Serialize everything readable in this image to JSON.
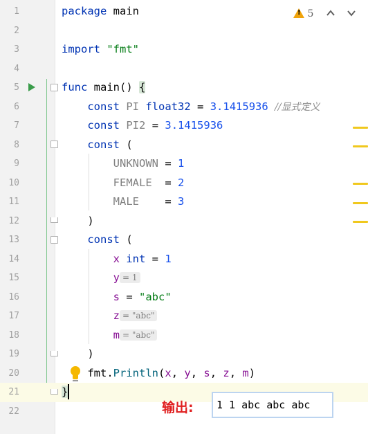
{
  "editor": {
    "warnings": {
      "icon": "warning-triangle-icon",
      "count": "5"
    },
    "nav": {
      "prev_icon": "chevron-up-icon",
      "next_icon": "chevron-down-icon",
      "prev_glyph": "⌃",
      "next_glyph": "⌄"
    },
    "line_numbers": [
      "1",
      "2",
      "3",
      "4",
      "5",
      "6",
      "7",
      "8",
      "9",
      "10",
      "11",
      "12",
      "13",
      "14",
      "15",
      "16",
      "17",
      "18",
      "19",
      "20",
      "21",
      "22"
    ],
    "lines": {
      "l1_kw": "package",
      "l1_name": "main",
      "l3_kw": "import",
      "l3_str": "\"fmt\"",
      "l5_kw": "func",
      "l5_name": "main",
      "l6_kw": "const",
      "l6_name": "PI",
      "l6_type": "float32",
      "l6_eq": "=",
      "l6_num": "3.1415936",
      "l6_comment": "//显式定义",
      "l7_kw": "const",
      "l7_name": "PI2",
      "l7_eq": "=",
      "l7_num": "3.1415936",
      "l8_kw": "const",
      "l9_name": "UNKNOWN",
      "l9_num": "1",
      "l10_name": "FEMALE ",
      "l10_num": "2",
      "l11_name": "MALE   ",
      "l11_num": "3",
      "l13_kw": "const",
      "l14_name": "x",
      "l14_type": "int",
      "l14_num": "1",
      "l15_name": "y",
      "l15_hint": "= 1",
      "l16_name": "s",
      "l16_str": "\"abc\"",
      "l17_name": "z",
      "l17_hint": "= \"abc\"",
      "l18_name": "m",
      "l18_hint": "= \"abc\"",
      "l20_pkg": "fmt",
      "l20_fn": "Println",
      "l20_args_x": "x",
      "l20_args_y": "y",
      "l20_args_s": "s",
      "l20_args_z": "z",
      "l20_args_m": "m"
    }
  },
  "annotation": {
    "output_label": "输出:",
    "output_value": "1 1 abc abc abc"
  },
  "colors": {
    "keyword": "#0033b3",
    "string": "#067d17",
    "number": "#1750eb",
    "constant": "#871094",
    "warning": "#f0a30a",
    "output_label": "#e02020"
  }
}
